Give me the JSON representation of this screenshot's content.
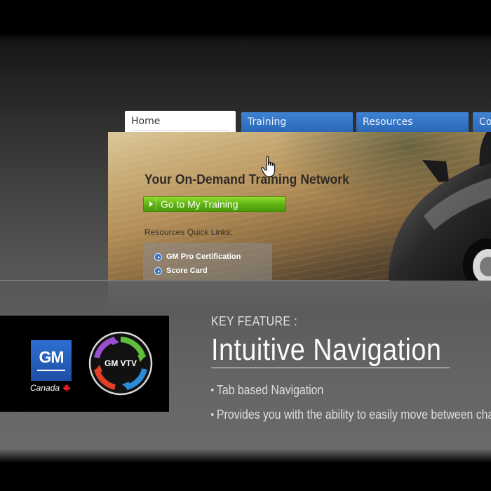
{
  "tabs": [
    {
      "label": "Home",
      "active": true
    },
    {
      "label": "Training",
      "active": false
    },
    {
      "label": "Resources",
      "active": false
    },
    {
      "label": "Co",
      "active": false
    }
  ],
  "hero": {
    "title": "Your On-Demand Training Network",
    "cta_label": "Go to My Training",
    "quick_links_label": "Resources Quick Links:",
    "quick_links": [
      "GM Pro Certification",
      "Score Card"
    ]
  },
  "logos": {
    "gm": "GM",
    "canada": "Canada",
    "vtv": "GM VTV"
  },
  "feature": {
    "label": "KEY FEATURE :",
    "title": "Intuitive Navigation",
    "bullets": [
      "Tab based Navigation",
      "Provides you with the ability to easily move between cha"
    ]
  },
  "colors": {
    "tab_blue": "#3a7bd0",
    "cta_green": "#5cb011",
    "gm_blue": "#2a62c0"
  },
  "icons": [
    "hand-cursor-icon",
    "arrow-icon",
    "maple-leaf-icon",
    "vtv-cycle-icon"
  ]
}
